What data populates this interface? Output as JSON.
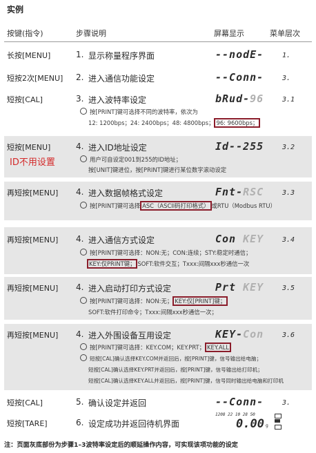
{
  "title": "实例",
  "headers": {
    "key": "按键(指令)",
    "steps": "步骤说明",
    "display": "屏幕显示",
    "menu": "菜单层次"
  },
  "rows": [
    {
      "key": "长按[MENU]",
      "num": "1.",
      "step": "显示称量程序界面",
      "display": "--nodE-",
      "menu": "1."
    },
    {
      "key": "短按2次[MENU]",
      "num": "2.",
      "step": "进入通信功能设定",
      "display": "--Conn-",
      "menu": "3."
    },
    {
      "key": "短按[CAL]",
      "num": "3.",
      "step": "进入波特率设定",
      "display_main": "bRud-",
      "display_dim": "96",
      "menu": "3.1",
      "note1": "按[PRINT]键可选择不同的波特率，依次为",
      "note2": "12: 1200bps；24: 2400bps；48: 4800bps；",
      "note2_hl": "96: 9600bps；"
    },
    {
      "key": "短按[MENU]",
      "key_red": "ID不用设置",
      "num": "4.",
      "step": "进入ID地址设定",
      "display": "Id--255",
      "menu": "3.2",
      "note1": "用户可自设定001到255的ID地址；",
      "note2": "按[UNIT]键进位，按[PRINT]键进行某位数字滚动设定"
    },
    {
      "key": "再短按[MENU]",
      "num": "4.",
      "step": "进入数据帧格式设定",
      "display_main": "Fnt-",
      "display_dim": "RSC",
      "menu": "3.3",
      "note_a": "按[PRINT]键可选择",
      "note_hl": "ASC（ASCII码打印格式）",
      "note_b": "或RTU（Modbus RTU）"
    },
    {
      "key": "再短按[MENU]",
      "num": "4.",
      "step": "进入通信方式设定",
      "display_main": "Con ",
      "display_dim": "KEY",
      "menu": "3.4",
      "note1": "按[PRINT]键可选择：NON:无；CON:连续；STY:稳定时通信；",
      "note2_hl": "KEY:仅PRINT键；",
      "note2": "SOFT:软件交互；Txxx:间隔xxx秒通信一次"
    },
    {
      "key": "再短按[MENU]",
      "num": "4.",
      "step": "进入启动打印方式设定",
      "display_main": "Prt ",
      "display_dim": "KEY",
      "menu": "3.5",
      "note_a": "按[PRINT]键可选择：NON:无；",
      "note_hl": "KEY:仅[PRINT]键；",
      "note2": "SOFT:软件打印命令；Txxx:间隔xxx秒通信一次；"
    },
    {
      "key": "再短按[MENU]",
      "num": "4.",
      "step": "进入外围设备互用设定",
      "display_main": "KEY-",
      "display_dim": "Con",
      "menu": "3.6",
      "note_a": "按[PRINT]键可选择：KEY.COM；KEY.PRT；",
      "note_hl": "KEY.ALL",
      "note2": "短按[CAL]确认选择KEY.COM并返回后，按[PRINT]键，信号输出给电脑；",
      "note3": "短按[CAL]确认选择KEY.PRT并返回后，按[PRINT]键，信号输出给打印机；",
      "note4": "短按[CAL]确认选择KEY.ALL并返回后，按[PRINT]键，信号同时输出给电脑和打印机"
    },
    {
      "key": "短按[CAL]",
      "num": "5.",
      "step": "确认设定并返回",
      "display": "--Conn-",
      "menu": "3."
    },
    {
      "key": "短按[TARE]",
      "num": "6.",
      "step": "设定成功并返回待机界面",
      "lcd_top": "1208 22  10 28 50",
      "lcd_main": "0.00",
      "lcd_unit": "g"
    }
  ],
  "footer": "注：页面灰底部份为步骤1–3波特率设定后的顺延操作内容，可实现该项功能的设定"
}
